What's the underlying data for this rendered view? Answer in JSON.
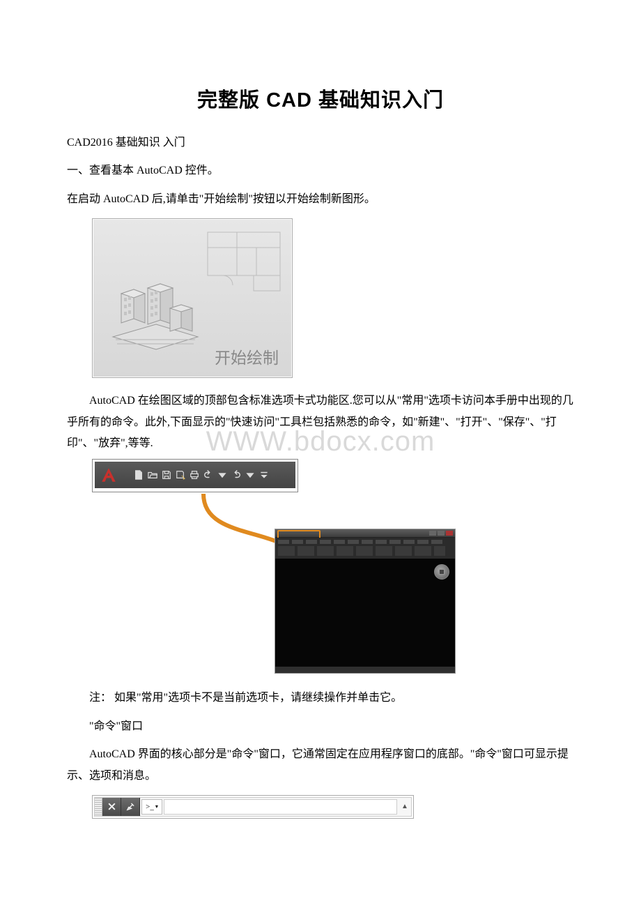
{
  "title": "完整版 CAD 基础知识入门",
  "p1": "CAD2016 基础知识 入门",
  "p2": "一、查看基本 AutoCAD 控件。",
  "p3": "在启动 AutoCAD 后,请单击\"开始绘制\"按钮以开始绘制新图形。",
  "fig1_label": "开始绘制",
  "p4": "AutoCAD 在绘图区域的顶部包含标准选项卡式功能区.您可以从\"常用\"选项卡访问本手册中出现的几乎所有的命令。此外,下面显示的\"快速访问\"工具栏包括熟悉的命令，如\"新建\"、\"打开\"、\"保存\"、\"打印\"、\"放弃\",等等.",
  "watermark": "WWW.bdocx.com",
  "p5": "注：  如果\"常用\"选项卡不是当前选项卡，请继续操作并单击它。",
  "p6": "\"命令\"窗口",
  "p7": "AutoCAD 界面的核心部分是\"命令\"窗口，它通常固定在应用程序窗口的底部。\"命令\"窗口可显示提示、选项和消息。",
  "cmd_prompt": ">_",
  "cmd_tri": "▲"
}
